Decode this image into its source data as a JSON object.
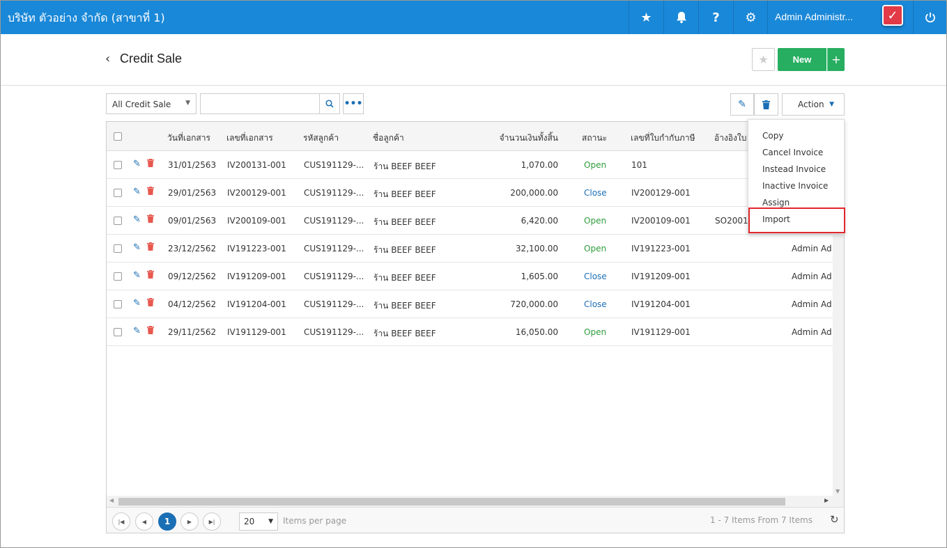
{
  "topbar": {
    "company": "บริษัท ตัวอย่าง จำกัด (สาขาที่ 1)",
    "user_name": "Admin Administr...",
    "icons": [
      "star-icon",
      "bell-icon",
      "help-icon",
      "gear-icon",
      "power-icon"
    ]
  },
  "header": {
    "title": "Credit Sale",
    "new_label": "New",
    "new_plus": "+"
  },
  "toolbar": {
    "filter_value": "All Credit Sale",
    "search_placeholder": "",
    "action_label": "Action"
  },
  "grid": {
    "columns": [
      "วันที่เอกสาร",
      "เลขที่เอกสาร",
      "รหัสลูกค้า",
      "ชื่อลูกค้า",
      "จำนวนเงินทั้งสิ้น",
      "สถานะ",
      "เลขที่ใบกำกับภาษี",
      "อ้างอิงใบ"
    ],
    "rows": [
      {
        "date": "31/01/2563",
        "doc": "IV200131-001",
        "cust_code": "CUS191129-...",
        "cust_name": "ร้าน BEEF BEEF",
        "amount": "1,070.00",
        "status": "Open",
        "tax_inv": "101",
        "ref": "",
        "user": ""
      },
      {
        "date": "29/01/2563",
        "doc": "IV200129-001",
        "cust_code": "CUS191129-...",
        "cust_name": "ร้าน BEEF BEEF",
        "amount": "200,000.00",
        "status": "Close",
        "tax_inv": "IV200129-001",
        "ref": "",
        "user": ""
      },
      {
        "date": "09/01/2563",
        "doc": "IV200109-001",
        "cust_code": "CUS191129-...",
        "cust_name": "ร้าน BEEF BEEF",
        "amount": "6,420.00",
        "status": "Open",
        "tax_inv": "IV200109-001",
        "ref": "SO2001",
        "user": ""
      },
      {
        "date": "23/12/2562",
        "doc": "IV191223-001",
        "cust_code": "CUS191129-...",
        "cust_name": "ร้าน BEEF BEEF",
        "amount": "32,100.00",
        "status": "Open",
        "tax_inv": "IV191223-001",
        "ref": "",
        "user": "Admin Adr"
      },
      {
        "date": "09/12/2562",
        "doc": "IV191209-001",
        "cust_code": "CUS191129-...",
        "cust_name": "ร้าน BEEF BEEF",
        "amount": "1,605.00",
        "status": "Close",
        "tax_inv": "IV191209-001",
        "ref": "",
        "user": "Admin Adr"
      },
      {
        "date": "04/12/2562",
        "doc": "IV191204-001",
        "cust_code": "CUS191129-...",
        "cust_name": "ร้าน BEEF BEEF",
        "amount": "720,000.00",
        "status": "Close",
        "tax_inv": "IV191204-001",
        "ref": "",
        "user": "Admin Adr"
      },
      {
        "date": "29/11/2562",
        "doc": "IV191129-001",
        "cust_code": "CUS191129-...",
        "cust_name": "ร้าน BEEF BEEF",
        "amount": "16,050.00",
        "status": "Open",
        "tax_inv": "IV191129-001",
        "ref": "",
        "user": "Admin Adr"
      }
    ]
  },
  "pager": {
    "current_page": "1",
    "per_page": "20",
    "per_page_label": "Items per page",
    "info": "1 - 7 Items From 7 Items"
  },
  "action_menu": {
    "items": [
      "Copy",
      "Cancel Invoice",
      "Instead Invoice",
      "Inactive Invoice",
      "Assign",
      "Import"
    ],
    "highlighted": "Import"
  },
  "colors": {
    "topbar": "#1a88d8",
    "new_button": "#27ae60",
    "status_open": "#2f9c3c",
    "status_close": "#1a6fb5",
    "highlight_border": "#e0262c"
  }
}
